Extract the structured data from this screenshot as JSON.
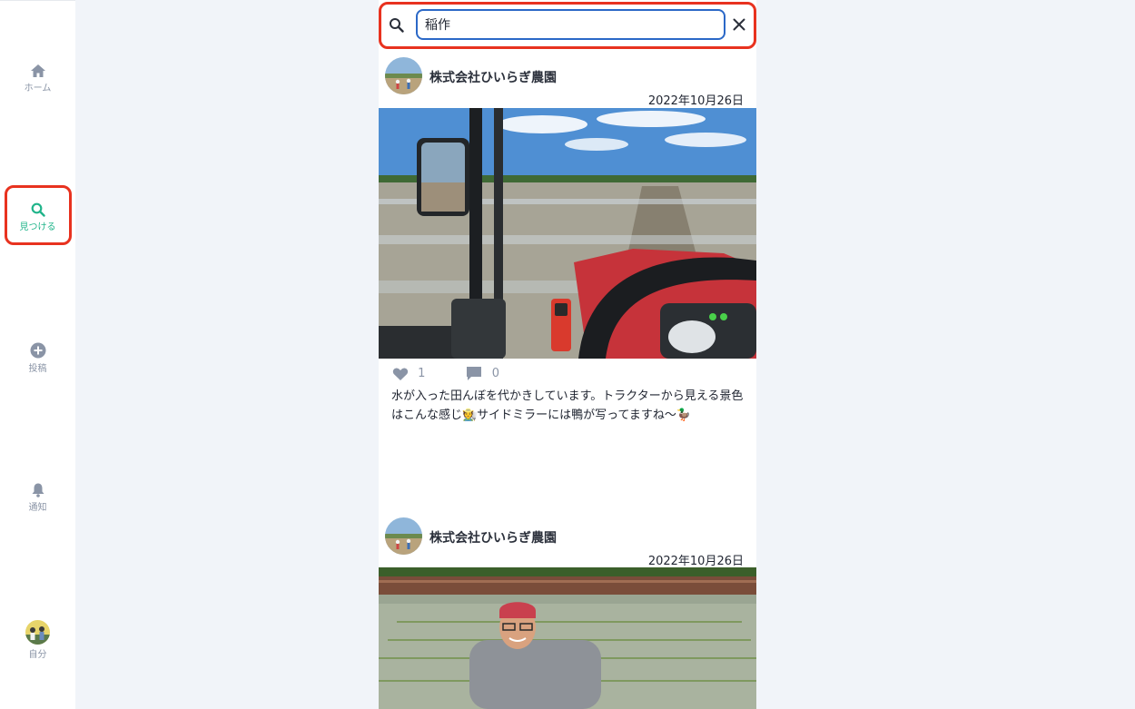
{
  "nav": {
    "home": "ホーム",
    "discover": "見つける",
    "post": "投稿",
    "notifications": "通知",
    "me": "自分"
  },
  "search": {
    "value": "稲作",
    "placeholder": ""
  },
  "posts": [
    {
      "author": "株式会社ひいらぎ農園",
      "date": "2022年10月26日",
      "likes": "1",
      "comments": "0",
      "caption": "水が入った田んぼを代かきしています。トラクターから見える景色はこんな感じ🧑‍🌾サイドミラーには鴨が写ってますね〜🦆"
    },
    {
      "author": "株式会社ひいらぎ農園",
      "date": "2022年10月26日"
    }
  ],
  "colors": {
    "accent": "#20b48a",
    "highlight": "#e8321f",
    "input_border": "#2b68c7",
    "nav_inactive": "#8a94a6",
    "background": "#f1f4f9"
  },
  "icons": [
    "home-icon",
    "search-icon",
    "plus-circle-icon",
    "bell-icon",
    "close-icon",
    "heart-icon",
    "comment-icon"
  ]
}
